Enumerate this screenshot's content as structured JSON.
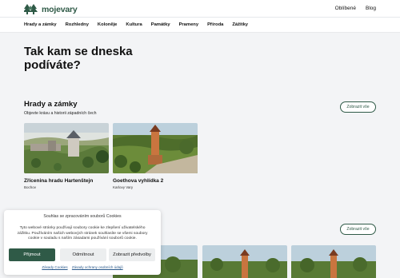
{
  "brand": {
    "name": "mojevary"
  },
  "topnav": {
    "favorites": "Oblíbené",
    "blog": "Blog"
  },
  "categories": [
    "Hrady a zámky",
    "Rozhledny",
    "Koloněje",
    "Kultura",
    "Památky",
    "Prameny",
    "Příroda",
    "Zážitky"
  ],
  "hero": {
    "title": "Tak kam se dneska podíváte?"
  },
  "section1": {
    "title": "Hrady a zámky",
    "subtitle": "Objevte krásu a historii západních čech",
    "show_all": "Zobrazit vše",
    "cards": [
      {
        "title": "Zřícenina hradu Hartenštejn",
        "location": "Bochov"
      },
      {
        "title": "Goethova vyhlídka 2",
        "location": "Karlovy Vary"
      }
    ]
  },
  "section2": {
    "show_all": "Zobrazit vše"
  },
  "cookie": {
    "title": "Souhlas se zpracováním souborů Cookies",
    "body": "Tyto webové stránky používají soubory cookie ke zlepšení uživatelského zážitku. Používáním našich webových stránek souhlasíte se všemi soubory cookie v souladu s naším zásadami používání souborů cookie.",
    "accept": "Přijmout",
    "deny": "Odmítnout",
    "preferences": "Zobrazit předvolby",
    "link_cookies": "Zásady Cookies",
    "link_privacy": "Zásady ochrany osobních údajů"
  },
  "colors": {
    "accent": "#2f5a47",
    "background": "#f3f4f6"
  }
}
